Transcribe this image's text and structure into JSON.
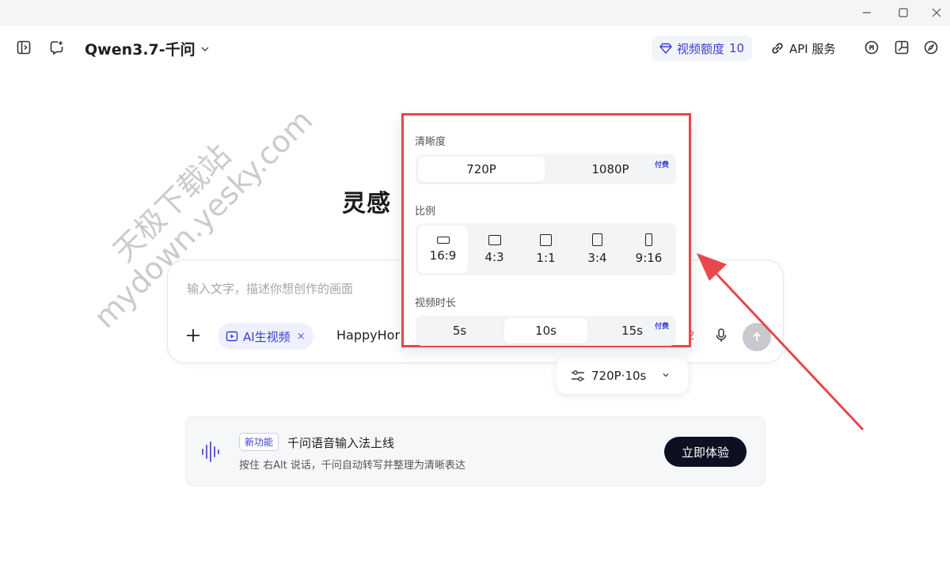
{
  "window": {
    "minimize": "—",
    "maximize": "▢",
    "close": "✕"
  },
  "topbar": {
    "model": "Qwen3.7-千问",
    "quota_label": "视频额度",
    "quota_count": "10",
    "api_label": "API 服务"
  },
  "hero": {
    "title_visible": "灵感"
  },
  "watermark": {
    "line1": "天极下载站",
    "line2": "mydown.yesky.com"
  },
  "composer": {
    "placeholder": "输入文字，描述你想创作的画面",
    "mode_chip": "AI生视频",
    "mode_chip_close": "×",
    "model_select": "HappyHor",
    "count_fragment": "2",
    "settings_summary": "720P·10s"
  },
  "popup": {
    "resolution_label": "清晰度",
    "resolution_options": [
      "720P",
      "1080P"
    ],
    "resolution_selected": "720P",
    "paid_tag": "付费",
    "ratio_label": "比例",
    "ratio_options": [
      "16:9",
      "4:3",
      "1:1",
      "3:4",
      "9:16"
    ],
    "ratio_selected": "16:9",
    "duration_label": "视频时长",
    "duration_options": [
      "5s",
      "10s",
      "15s"
    ],
    "duration_selected": "10s"
  },
  "banner": {
    "badge": "新功能",
    "title": "千问语音输入法上线",
    "description": "按住 右Alt 说话，千问自动转写并整理为清晰表达",
    "button": "立即体验"
  },
  "colors": {
    "accent": "#3a3fd0",
    "highlight_border": "#e8474b",
    "button_dark": "#0e1022"
  }
}
